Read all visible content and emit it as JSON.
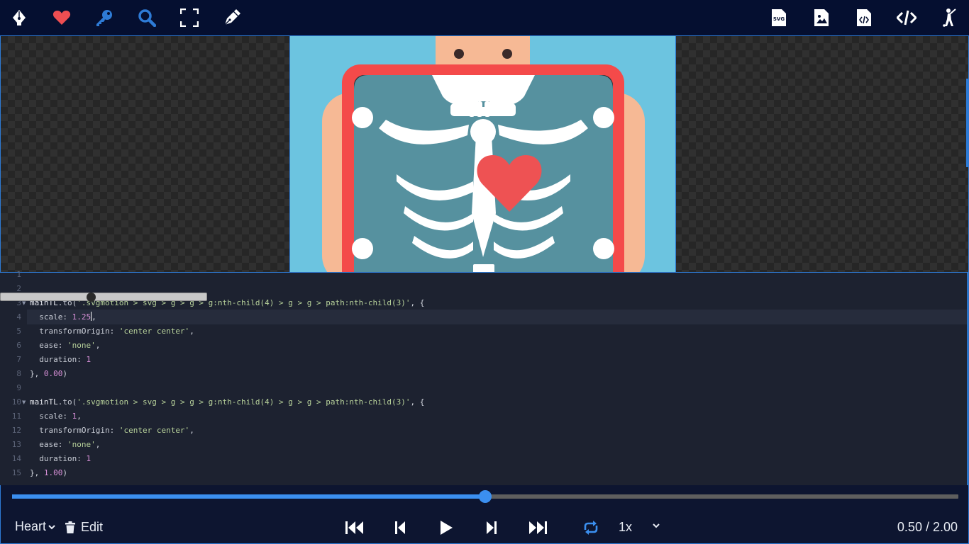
{
  "toolbar": {
    "left_icons": [
      "pen-nib-icon",
      "heart-icon",
      "key-icon",
      "search-icon",
      "expand-icon",
      "pen-edit-icon"
    ],
    "right_icons": [
      "svg-file-icon",
      "image-file-icon",
      "code-file-icon",
      "code-icon",
      "golfer-icon"
    ],
    "svg_badge": "SVG"
  },
  "colors": {
    "toolbar_bg": "#050f30",
    "accent_blue": "#2e7bd6",
    "heart_red": "#ee4e52",
    "artboard_sky": "#6cc4e0",
    "frame_red": "#f44a4a",
    "chest_teal": "#56919f",
    "skin": "#f6b995"
  },
  "editor": {
    "line_numbers": [
      "1",
      "2",
      "3",
      "4",
      "5",
      "6",
      "7",
      "8",
      "9",
      "10",
      "11",
      "12",
      "13",
      "14",
      "15"
    ],
    "folds": [
      "3",
      "10"
    ],
    "lines": {
      "l3": {
        "obj": "mainTL",
        "method": ".to(",
        "selector": "'.svgmotion > svg > g > g > g:nth-child(4) > g > g > path:nth-child(3)'",
        "tail": ", {"
      },
      "l4": {
        "prop": "  scale: ",
        "value": "1.25",
        "tail": ","
      },
      "l5": {
        "prop": "  transformOrigin: ",
        "value": "'center center'",
        "tail": ","
      },
      "l6": {
        "prop": "  ease: ",
        "value": "'none'",
        "tail": ","
      },
      "l7": {
        "prop": "  duration: ",
        "value": "1"
      },
      "l8": {
        "head": "}, ",
        "value": "0.00",
        "tail": ")"
      },
      "l10": {
        "obj": "mainTL",
        "method": ".to(",
        "selector": "'.svgmotion > svg > g > g > g:nth-child(4) > g > g > path:nth-child(3)'",
        "tail": ", {"
      },
      "l11": {
        "prop": "  scale: ",
        "value": "1",
        "tail": ","
      },
      "l12": {
        "prop": "  transformOrigin: ",
        "value": "'center center'",
        "tail": ","
      },
      "l13": {
        "prop": "  ease: ",
        "value": "'none'",
        "tail": ","
      },
      "l14": {
        "prop": "  duration: ",
        "value": "1"
      },
      "l15": {
        "head": "}, ",
        "value": "1.00",
        "tail": ")"
      }
    }
  },
  "timeline": {
    "progress": 0.5,
    "animation_name": "Heart",
    "edit_label": "Edit",
    "speed": "1x",
    "time_display": "0.50 / 2.00",
    "controls": [
      "skip-start-icon",
      "step-back-icon",
      "play-icon",
      "step-forward-icon",
      "skip-end-icon",
      "loop-icon"
    ]
  }
}
